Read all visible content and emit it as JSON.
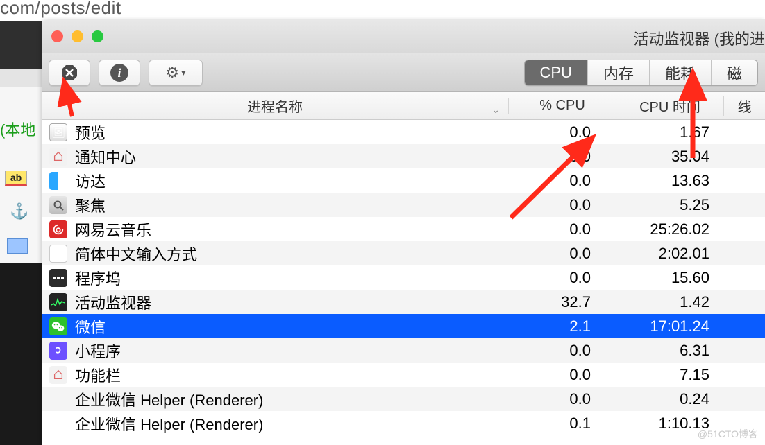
{
  "browser_url_fragment": "com/posts/edit",
  "local_label": "(本地",
  "ab_text": "ab",
  "window": {
    "title": "活动监视器 (我的进"
  },
  "toolbar": {
    "stop_icon": "stop-octagon",
    "info_icon": "info",
    "gear_icon": "gear",
    "tabs": [
      "CPU",
      "内存",
      "能耗",
      "磁"
    ],
    "active_tab_index": 0
  },
  "columns": {
    "name": "进程名称",
    "cpu": "% CPU",
    "time": "CPU 时间",
    "last": "线"
  },
  "processes": [
    {
      "icon": "preview",
      "name": "预览",
      "cpu": "0.0",
      "time": "1.67"
    },
    {
      "icon": "notif",
      "name": "通知中心",
      "cpu": "0.0",
      "time": "35.04"
    },
    {
      "icon": "finder",
      "name": "访达",
      "cpu": "0.0",
      "time": "13.63"
    },
    {
      "icon": "spotlight",
      "name": "聚焦",
      "cpu": "0.0",
      "time": "5.25"
    },
    {
      "icon": "netease",
      "name": "网易云音乐",
      "cpu": "0.0",
      "time": "25:26.02"
    },
    {
      "icon": "ime",
      "name": "简体中文输入方式",
      "cpu": "0.0",
      "time": "2:02.01"
    },
    {
      "icon": "dock",
      "name": "程序坞",
      "cpu": "0.0",
      "time": "15.60"
    },
    {
      "icon": "activity",
      "name": "活动监视器",
      "cpu": "32.7",
      "time": "1.42"
    },
    {
      "icon": "wechat",
      "name": "微信",
      "cpu": "2.1",
      "time": "17:01.24",
      "selected": true
    },
    {
      "icon": "mini",
      "name": "小程序",
      "cpu": "0.0",
      "time": "6.31"
    },
    {
      "icon": "bar",
      "name": "功能栏",
      "cpu": "0.0",
      "time": "7.15"
    },
    {
      "icon": "",
      "name": "企业微信 Helper (Renderer)",
      "cpu": "0.0",
      "time": "0.24"
    },
    {
      "icon": "",
      "name": "企业微信 Helper (Renderer)",
      "cpu": "0.1",
      "time": "1:10.13"
    }
  ],
  "watermark": "@51CTO博客"
}
